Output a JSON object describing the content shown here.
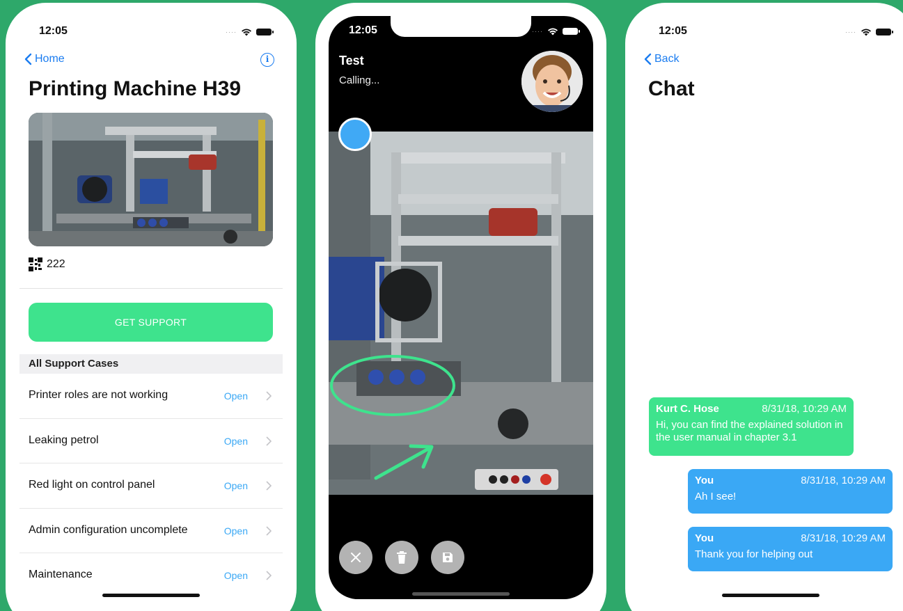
{
  "statusbar": {
    "time": "12:05"
  },
  "detail": {
    "back_label": "Home",
    "title": "Printing Machine H39",
    "machine_id": "222",
    "support_button": "GET SUPPORT",
    "section_header": "All Support Cases",
    "cases": [
      {
        "title": "Printer roles are not working",
        "status": "Open"
      },
      {
        "title": "Leaking petrol",
        "status": "Open"
      },
      {
        "title": "Red light on control panel",
        "status": "Open"
      },
      {
        "title": "Admin configuration uncomplete",
        "status": "Open"
      },
      {
        "title": "Maintenance",
        "status": "Open"
      }
    ]
  },
  "call": {
    "caller": "Test",
    "status": "Calling..."
  },
  "chat": {
    "back_label": "Back",
    "title": "Chat",
    "messages": [
      {
        "sender": "Kurt C. Hose",
        "time": "8/31/18, 10:29 AM",
        "text": "Hi, you can find the explained solution in the user manual in chapter 3.1"
      },
      {
        "sender": "You",
        "time": "8/31/18, 10:29 AM",
        "text": "Ah I see!"
      },
      {
        "sender": "You",
        "time": "8/31/18, 10:29 AM",
        "text": "Thank you for helping out"
      }
    ]
  },
  "colors": {
    "background": "#2ea86a",
    "accent_blue": "#1a7cf0",
    "green": "#3ee38d",
    "bubble_blue": "#3aa8f5"
  }
}
